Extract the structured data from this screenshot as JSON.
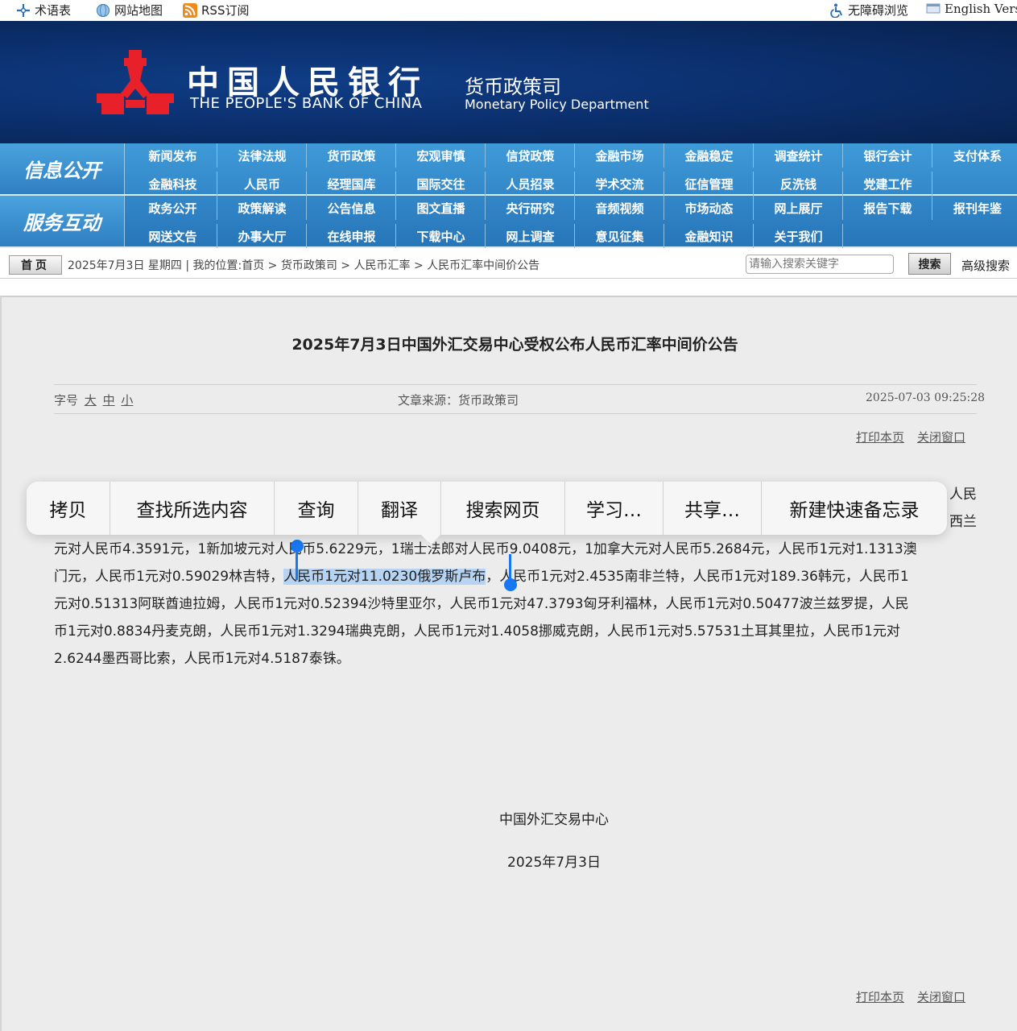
{
  "topbar": {
    "glossary": "术语表",
    "sitemap": "网站地图",
    "rss": "RSS订阅",
    "accessible": "无障碍浏览",
    "english": "English Versio"
  },
  "banner": {
    "cn_name": "中国人民银行",
    "en_name": "THE PEOPLE'S BANK OF CHINA",
    "dept_cn": "货币政策司",
    "dept_en": "Monetary Policy Department"
  },
  "nav": {
    "label1": "信息公开",
    "label2": "服务互动",
    "row1a": [
      "新闻发布",
      "法律法规",
      "货币政策",
      "宏观审慎",
      "信贷政策",
      "金融市场",
      "金融稳定",
      "调查统计",
      "银行会计",
      "支付体系"
    ],
    "row1b": [
      "金融科技",
      "人民币",
      "经理国库",
      "国际交往",
      "人员招录",
      "学术交流",
      "征信管理",
      "反洗钱",
      "党建工作"
    ],
    "row2a": [
      "政务公开",
      "政策解读",
      "公告信息",
      "图文直播",
      "央行研究",
      "音频视频",
      "市场动态",
      "网上展厅",
      "报告下载",
      "报刊年鉴"
    ],
    "row2b": [
      "网送文告",
      "办事大厅",
      "在线申报",
      "下载中心",
      "网上调查",
      "意见征集",
      "金融知识",
      "关于我们"
    ]
  },
  "crumb": {
    "home": "首页",
    "text": "2025年7月3日 星期四 | 我的位置:首页 > 货币政策司 > 人民币汇率 > 人民币汇率中间价公告",
    "search_placeholder": "请输入搜索关键字",
    "search_button": "搜索",
    "advanced": "高级搜索"
  },
  "article": {
    "title": "2025年7月3日中国外汇交易中心受权公布人民币汇率中间价公告",
    "font_size_label": "字号",
    "font_large": "大",
    "font_medium": "中",
    "font_small": "小",
    "source": "文章来源：货币政策司",
    "date": "2025-07-03 09:25:28",
    "print": "打印本页",
    "close": "关闭窗口",
    "line1_tail": "人民",
    "line2_tail": "西兰",
    "line3": "元对人民币4.3591元，1新加坡元对人民币5.6229元，1瑞士法郎对人民币9.0408元，1加拿大元对人民币5.2684元，人民币1元对1.1313澳",
    "line4_pre": "门元，人民币1元对0.59029林吉特，",
    "line4_sel": "人民币1元对11.0230俄罗斯卢布",
    "line4_post": "，人民币1元对2.4535南非兰特，人民币1元对189.36韩元，人民币1",
    "line5": "元对0.51313阿联酋迪拉姆，人民币1元对0.52394沙特里亚尔，人民币1元对47.3793匈牙利福林，人民币1元对0.50477波兰兹罗提，人民",
    "line6": "币1元对0.8834丹麦克朗，人民币1元对1.3294瑞典克朗，人民币1元对1.4058挪威克朗，人民币1元对5.57531土耳其里拉，人民币1元对",
    "line7": "2.6244墨西哥比索，人民币1元对4.5187泰铢。",
    "signer": "中国外汇交易中心",
    "sign_date": "2025年7月3日"
  },
  "context_menu": [
    "拷贝",
    "查找所选内容",
    "查询",
    "翻译",
    "搜索网页",
    "学习…",
    "共享…",
    "新建快速备忘录"
  ],
  "colors": {
    "banner": "#0b2e6b",
    "nav": "#2e82c4",
    "selection": "#b6d3f2",
    "handle": "#1877f2",
    "logo_red": "#e8202a"
  }
}
